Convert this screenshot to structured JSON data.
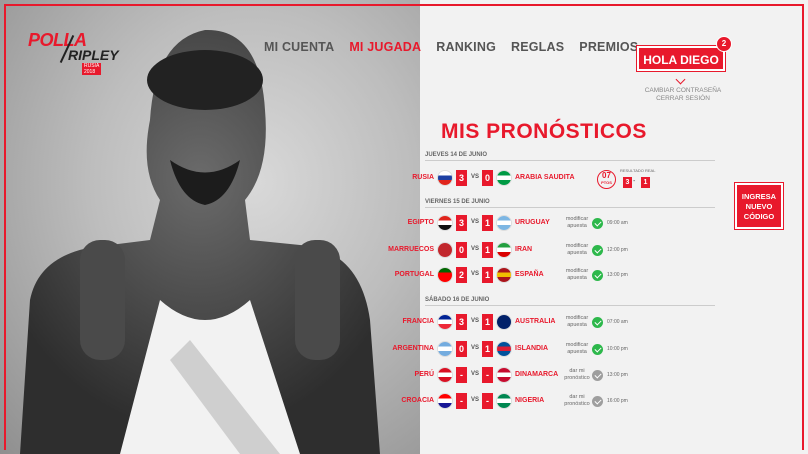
{
  "brand": {
    "polla": "POLLA",
    "ripley": "RIPLEY",
    "sub": "RUSIA 2018"
  },
  "nav": {
    "items": [
      "MI CUENTA",
      "MI JUGADA",
      "RANKING",
      "REGLAS",
      "PREMIOS"
    ],
    "active": "MI JUGADA"
  },
  "user": {
    "greeting": "HOLA DIEGO",
    "notifications": "2",
    "change_password": "CAMBIAR CONTRASEÑA",
    "logout": "CERRAR SESIÓN"
  },
  "cta": {
    "label": "INGRESA NUEVO CÓDIGO"
  },
  "page": {
    "title": "MIS PRONÓSTICOS"
  },
  "days": [
    {
      "label": "JUEVES 14 DE JUNIO"
    },
    {
      "label": "VIERNES 15 DE JUNIO"
    },
    {
      "label": "SÁBADO 16 DE JUNIO"
    }
  ],
  "result_box": {
    "value": "07",
    "unit": "PTOS",
    "label": "RESULTADO REAL",
    "home": "3",
    "away": "1"
  },
  "matches": [
    {
      "home": "RUSIA",
      "away": "ARABIA SAUDITA",
      "home_score": "3",
      "away_score": "0",
      "action": "",
      "time": ""
    },
    {
      "home": "EGIPTO",
      "away": "URUGUAY",
      "home_score": "3",
      "away_score": "1",
      "action": "modificar apuesta",
      "time": "09:00 am"
    },
    {
      "home": "MARRUECOS",
      "away": "IRAN",
      "home_score": "0",
      "away_score": "1",
      "action": "modificar apuesta",
      "time": "12:00 pm"
    },
    {
      "home": "PORTUGAL",
      "away": "ESPAÑA",
      "home_score": "2",
      "away_score": "1",
      "action": "modificar apuesta",
      "time": "13:00 pm"
    },
    {
      "home": "FRANCIA",
      "away": "AUSTRALIA",
      "home_score": "3",
      "away_score": "1",
      "action": "modificar apuesta",
      "time": "07:00 am"
    },
    {
      "home": "ARGENTINA",
      "away": "ISLANDIA",
      "home_score": "0",
      "away_score": "1",
      "action": "modificar apuesta",
      "time": "10:00 pm"
    },
    {
      "home": "PERÚ",
      "away": "DINAMARCA",
      "home_score": "-",
      "away_score": "-",
      "action": "dar mi pronóstico",
      "time": "13:00 pm"
    },
    {
      "home": "CROACIA",
      "away": "NIGERIA",
      "home_score": "-",
      "away_score": "-",
      "action": "dar mi pronóstico",
      "time": "16:00 pm"
    }
  ],
  "colors": {
    "accent": "#e8192c",
    "ok": "#2db84b",
    "pending": "#9e9e9e"
  }
}
